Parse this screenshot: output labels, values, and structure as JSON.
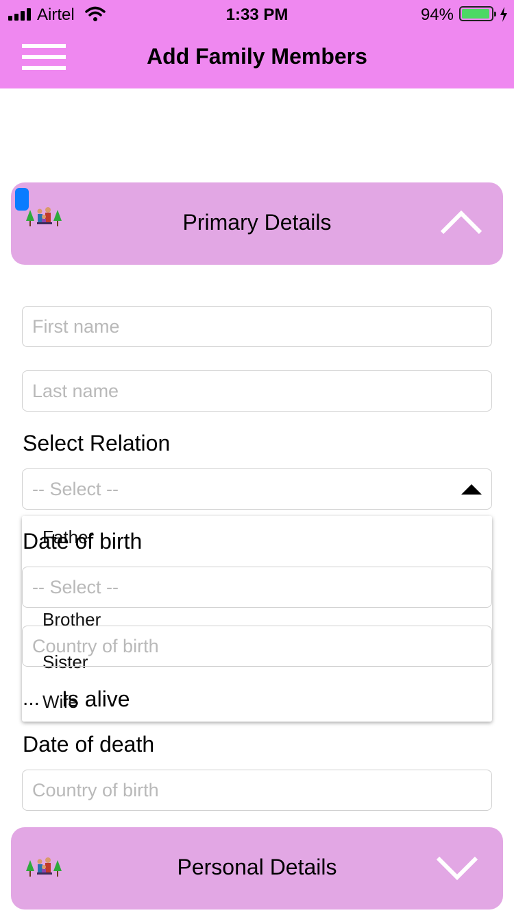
{
  "status_bar": {
    "carrier": "Airtel",
    "time": "1:33 PM",
    "battery": "94%"
  },
  "header": {
    "title": "Add Family Members",
    "menu_icon": "hamburger-menu-icon"
  },
  "primary_panel": {
    "title": "Primary Details",
    "icon": "family-icon",
    "toggle_icon": "chevron-up-icon"
  },
  "form": {
    "first_name_placeholder": "First name",
    "last_name_placeholder": "Last name",
    "relation_label": "Select Relation",
    "relation_placeholder": "-- Select --",
    "relation_options": [
      "Father",
      "Brother",
      "Sister",
      "Wife"
    ],
    "dob_label": "Date of birth",
    "dob_placeholder": "-- Select --",
    "country_of_birth_placeholder": "Country of birth",
    "is_alive_label": "Is alive",
    "ellipsis": "...",
    "dod_label": "Date of death",
    "dod_country_placeholder": "Country of birth"
  },
  "personal_panel": {
    "title": "Personal Details",
    "icon": "family-icon",
    "toggle_icon": "chevron-down-icon"
  },
  "colors": {
    "header": "#ef88f0",
    "panel": "#e2a7e4",
    "accent": "#0a7cff"
  }
}
